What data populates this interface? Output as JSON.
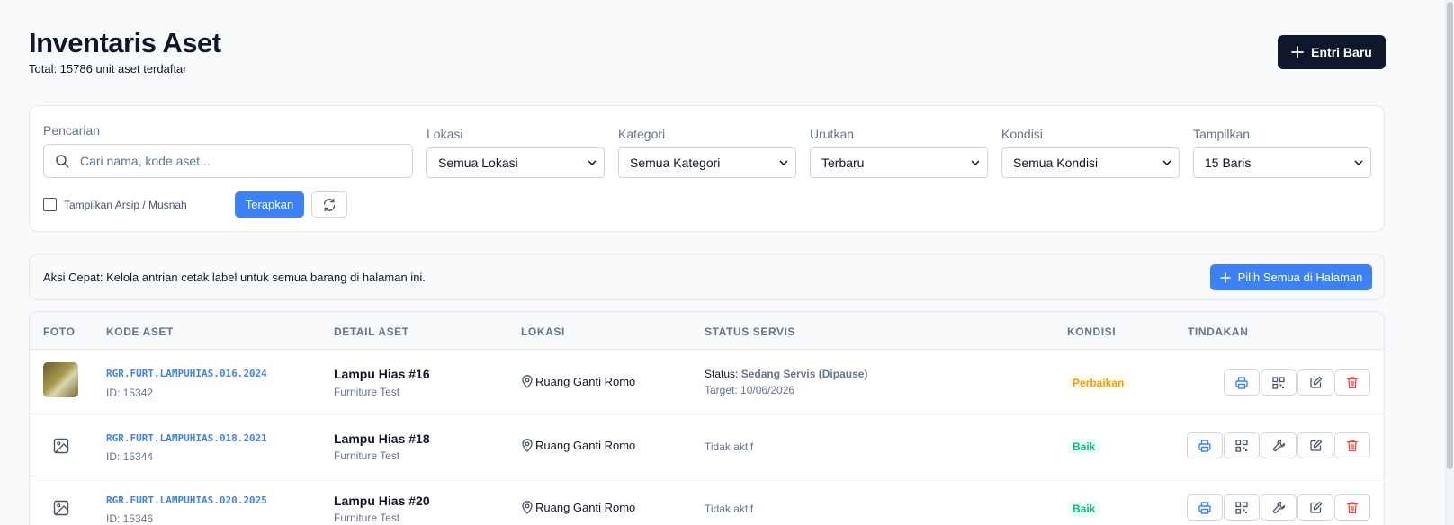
{
  "header": {
    "title": "Inventaris Aset",
    "subtitle": "Total: 15786 unit aset terdaftar",
    "new_button": "Entri Baru"
  },
  "filters": {
    "search_label": "Pencarian",
    "search_placeholder": "Cari nama, kode aset...",
    "search_value": "",
    "location_label": "Lokasi",
    "location_value": "Semua Lokasi",
    "category_label": "Kategori",
    "category_value": "Semua Kategori",
    "sort_label": "Urutkan",
    "sort_value": "Terbaru",
    "condition_label": "Kondisi",
    "condition_value": "Semua Kondisi",
    "show_label": "Tampilkan",
    "show_value": "15 Baris",
    "archive_checkbox_label": "Tampilkan Arsip / Musnah",
    "archive_checked": false,
    "apply_button": "Terapkan"
  },
  "quick_action": {
    "text": "Aksi Cepat: Kelola antrian cetak label untuk semua barang di halaman ini.",
    "button": "Pilih Semua di Halaman"
  },
  "table": {
    "columns": [
      "FOTO",
      "KODE ASET",
      "DETAIL ASET",
      "LOKASI",
      "STATUS SERVIS",
      "KONDISI",
      "TINDAKAN"
    ],
    "rows": [
      {
        "has_photo": true,
        "code": "RGR.FURT.LAMPUHIAS.016.2024",
        "id": "ID: 15342",
        "name": "Lampu Hias #16",
        "category": "Furniture Test",
        "location": "Ruang Ganti Romo",
        "status_prefix": "Status:",
        "status_value": "Sedang Servis (Dipause)",
        "target": "Target: 10/06/2026",
        "condition": "Perbaikan",
        "condition_type": "warning",
        "actions": [
          "print-icon",
          "qr-icon",
          "edit-icon",
          "trash-icon"
        ]
      },
      {
        "has_photo": false,
        "code": "RGR.FURT.LAMPUHIAS.018.2021",
        "id": "ID: 15344",
        "name": "Lampu Hias #18",
        "category": "Furniture Test",
        "location": "Ruang Ganti Romo",
        "status_text": "Tidak aktif",
        "condition": "Baik",
        "condition_type": "ok",
        "actions": [
          "print-icon",
          "qr-icon",
          "wrench-icon",
          "edit-icon",
          "trash-icon"
        ]
      },
      {
        "has_photo": false,
        "code": "RGR.FURT.LAMPUHIAS.020.2025",
        "id": "ID: 15346",
        "name": "Lampu Hias #20",
        "category": "Furniture Test",
        "location": "Ruang Ganti Romo",
        "status_text": "Tidak aktif",
        "condition": "Baik",
        "condition_type": "ok",
        "actions": [
          "print-icon",
          "qr-icon",
          "wrench-icon",
          "edit-icon",
          "trash-icon"
        ]
      }
    ]
  },
  "colors": {
    "primary": "#3b82f6",
    "dark": "#0f172a",
    "warning": "#f59e0b",
    "success": "#10b981",
    "danger": "#ef4444"
  }
}
